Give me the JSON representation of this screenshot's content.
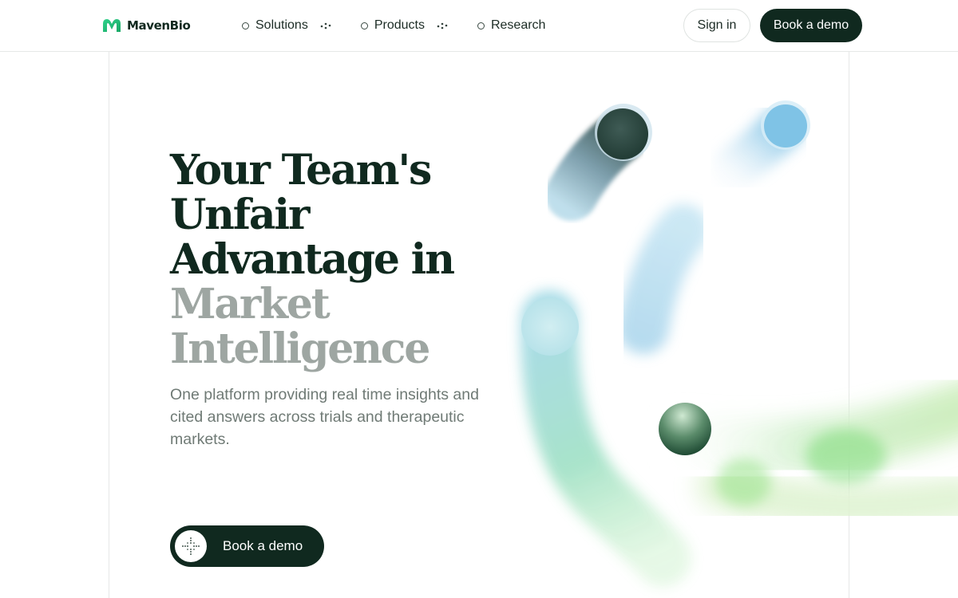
{
  "header": {
    "logo_text": "MavenBio",
    "nav": [
      {
        "label": "Solutions"
      },
      {
        "label": "Products"
      },
      {
        "label": "Research"
      }
    ],
    "sign_in_label": "Sign in",
    "book_demo_label": "Book a demo"
  },
  "hero": {
    "headline_lines": [
      "Your Team's",
      "Unfair",
      "Advantage in"
    ],
    "headline_muted_lines": [
      "Market",
      "Intelligence"
    ],
    "subtext": "One platform providing real time insights and cited answers across trials and therapeutic markets.",
    "cta_label": "Book a demo"
  },
  "colors": {
    "brand_dark": "#10291f",
    "brand_green": "#2fbf7a",
    "muted_text": "#9ea6a2"
  },
  "icons": {
    "logo": "maven-m-icon",
    "nav_dot": "circle-outline-icon",
    "nav_more": "dots-icon",
    "cta": "sparkle-dots-icon"
  }
}
